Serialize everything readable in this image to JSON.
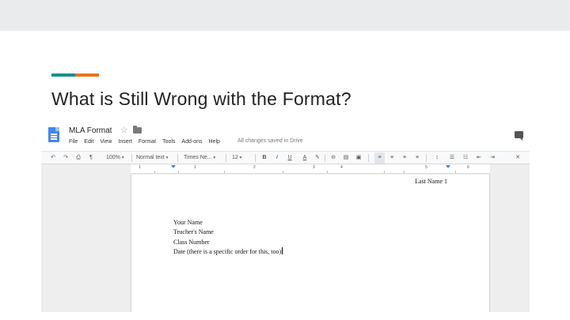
{
  "slide": {
    "title": "What is Still Wrong with the Format?",
    "accent_colors": [
      "#178f8c",
      "#e8741b"
    ]
  },
  "docs": {
    "doc_title": "MLA Format",
    "menu": [
      "File",
      "Edit",
      "View",
      "Insert",
      "Format",
      "Tools",
      "Add-ons",
      "Help"
    ],
    "save_status": "All changes saved in Drive",
    "toolbar": {
      "zoom": "100%",
      "style": "Normal text",
      "font": "Times Ne...",
      "font_size": "12",
      "bold": "B",
      "italic": "I",
      "underline": "U",
      "text_color": "A"
    },
    "ruler": [
      "1",
      "1",
      "2",
      "3",
      "4",
      "5",
      "6"
    ],
    "page": {
      "header": "Last Name 1",
      "lines": [
        "Your Name",
        "Teacher's Name",
        "Class Number",
        "Date (there is a specific order for this, too)"
      ]
    }
  }
}
